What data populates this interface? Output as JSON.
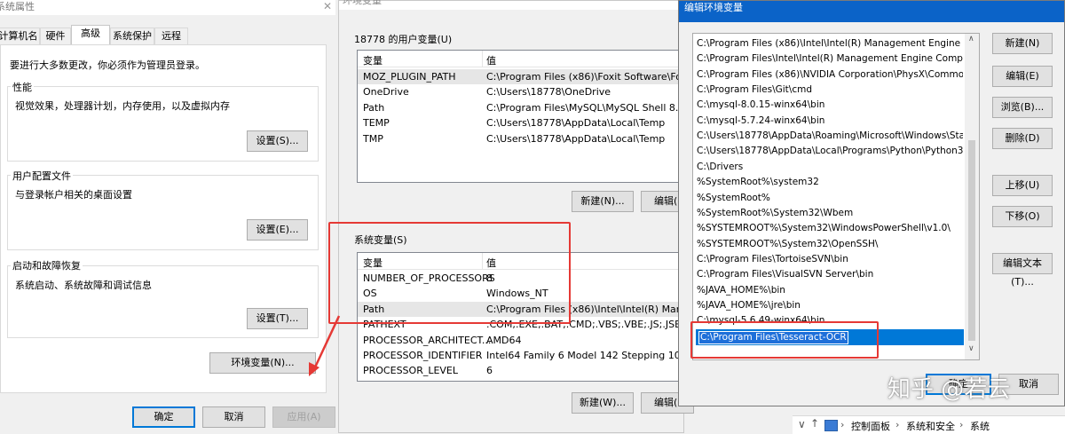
{
  "sys_props": {
    "title": "系统属性",
    "tabs": [
      "计算机名",
      "硬件",
      "高级",
      "系统保护",
      "远程"
    ],
    "admin_note": "要进行大多数更改，你必须作为管理员登录。",
    "performance": {
      "label": "性能",
      "desc": "视觉效果，处理器计划，内存使用，以及虚拟内存",
      "button": "设置(S)..."
    },
    "user_profile": {
      "label": "用户配置文件",
      "desc": "与登录帐户相关的桌面设置",
      "button": "设置(E)..."
    },
    "startup": {
      "label": "启动和故障恢复",
      "desc": "系统启动、系统故障和调试信息",
      "button": "设置(T)..."
    },
    "env_button": "环境变量(N)...",
    "ok": "确定",
    "cancel": "取消",
    "apply": "应用(A)"
  },
  "env_vars": {
    "title": "环境变量",
    "user_section": "18778 的用户变量(U)",
    "col_var": "变量",
    "col_val": "值",
    "user_vars": [
      {
        "name": "MOZ_PLUGIN_PATH",
        "value": "C:\\Program Files (x86)\\Foxit Software\\Foxit Ph"
      },
      {
        "name": "OneDrive",
        "value": "C:\\Users\\18778\\OneDrive"
      },
      {
        "name": "Path",
        "value": "C:\\Program Files\\MySQL\\MySQL Shell 8.0\\bin"
      },
      {
        "name": "TEMP",
        "value": "C:\\Users\\18778\\AppData\\Local\\Temp"
      },
      {
        "name": "TMP",
        "value": "C:\\Users\\18778\\AppData\\Local\\Temp"
      }
    ],
    "user_new": "新建(N)...",
    "user_edit": "编辑(",
    "system_section": "系统变量(S)",
    "system_vars": [
      {
        "name": "NUMBER_OF_PROCESSORS",
        "value": "8"
      },
      {
        "name": "OS",
        "value": "Windows_NT"
      },
      {
        "name": "Path",
        "value": "C:\\Program Files (x86)\\Intel\\Intel(R) Managem"
      },
      {
        "name": "PATHEXT",
        "value": ".COM;.EXE;.BAT;.CMD;.VBS;.VBE;.JS;.JSE;.WSF;"
      },
      {
        "name": "PROCESSOR_ARCHITECT...",
        "value": "AMD64"
      },
      {
        "name": "PROCESSOR_IDENTIFIER",
        "value": "Intel64 Family 6 Model 142 Stepping 10, Gen"
      },
      {
        "name": "PROCESSOR_LEVEL",
        "value": "6"
      }
    ],
    "system_new": "新建(W)...",
    "system_edit": "编辑("
  },
  "edit_env": {
    "title": "编辑环境变量",
    "entries": [
      "C:\\Program Files (x86)\\Intel\\Intel(R) Management Engine Co...",
      "C:\\Program Files\\Intel\\Intel(R) Management Engine Compon...",
      "C:\\Program Files (x86)\\NVIDIA Corporation\\PhysX\\Common",
      "C:\\Program Files\\Git\\cmd",
      "C:\\mysql-8.0.15-winx64\\bin",
      "C:\\mysql-5.7.24-winx64\\bin",
      "C:\\Users\\18778\\AppData\\Roaming\\Microsoft\\Windows\\Start...",
      "C:\\Users\\18778\\AppData\\Local\\Programs\\Python\\Python36\\...",
      "C:\\Drivers",
      "%SystemRoot%\\system32",
      "%SystemRoot%",
      "%SystemRoot%\\System32\\Wbem",
      "%SYSTEMROOT%\\System32\\WindowsPowerShell\\v1.0\\",
      "%SYSTEMROOT%\\System32\\OpenSSH\\",
      "C:\\Program Files\\TortoiseSVN\\bin",
      "C:\\Program Files\\VisualSVN Server\\bin",
      "%JAVA_HOME%\\bin",
      "%JAVA_HOME%\\jre\\bin",
      "C:\\mysql-5.6.49-winx64\\bin"
    ],
    "selected_entry": "C:\\Program Files\\Tesseract-OCR",
    "buttons": {
      "new": "新建(N)",
      "edit": "编辑(E)",
      "browse": "浏览(B)...",
      "delete": "删除(D)",
      "up": "上移(U)",
      "down": "下移(O)",
      "edit_text": "编辑文本(T)..."
    },
    "ok_partial": "确定",
    "cancel_partial": "取消"
  },
  "explorer_breadcrumb": [
    "控制面板",
    "系统和安全",
    "系统"
  ],
  "watermark": "知乎 @若云"
}
